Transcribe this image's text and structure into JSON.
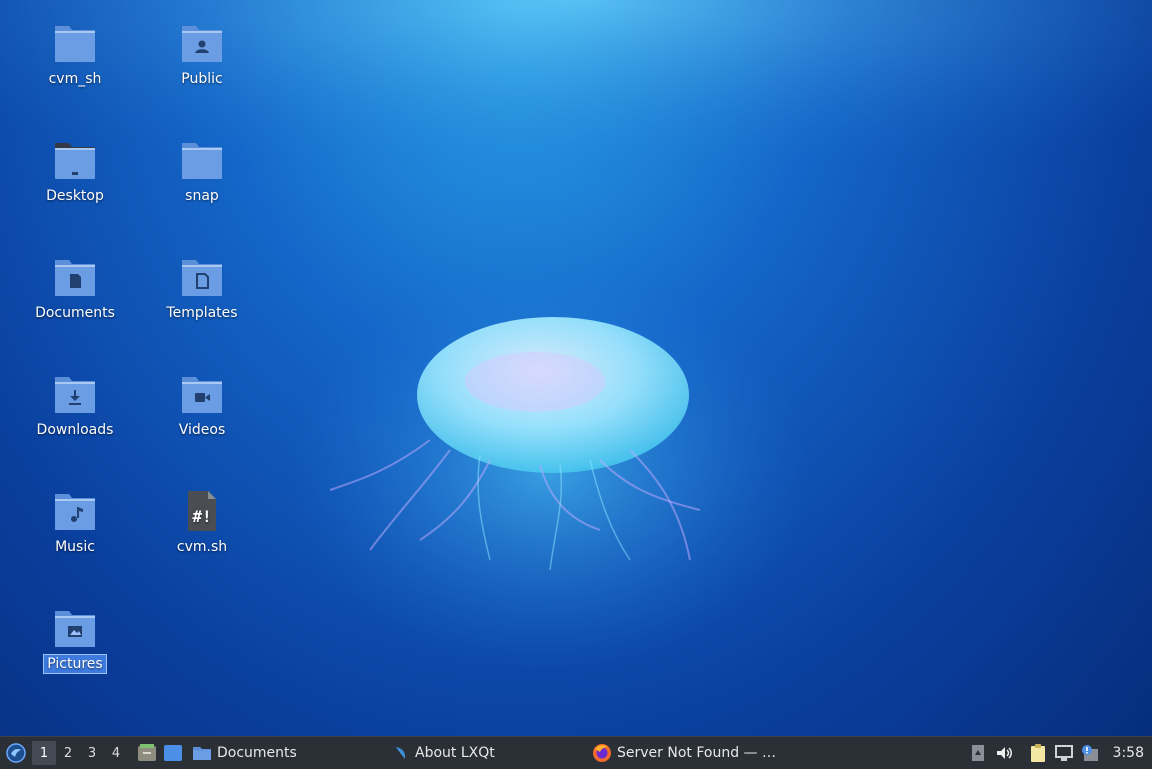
{
  "desktop": {
    "icons": [
      {
        "label": "cvm_sh",
        "icon": "folder-icon"
      },
      {
        "label": "Public",
        "icon": "folder-public-icon"
      },
      {
        "label": "Desktop",
        "icon": "folder-desktop-icon"
      },
      {
        "label": "snap",
        "icon": "folder-icon"
      },
      {
        "label": "Documents",
        "icon": "folder-documents-icon"
      },
      {
        "label": "Templates",
        "icon": "folder-templates-icon"
      },
      {
        "label": "Downloads",
        "icon": "folder-downloads-icon"
      },
      {
        "label": "Videos",
        "icon": "folder-videos-icon"
      },
      {
        "label": "Music",
        "icon": "folder-music-icon"
      },
      {
        "label": "cvm.sh",
        "icon": "shell-script-icon"
      },
      {
        "label": "Pictures",
        "icon": "folder-pictures-icon"
      }
    ],
    "selected": "Pictures"
  },
  "taskbar": {
    "workspaces": [
      "1",
      "2",
      "3",
      "4"
    ],
    "active_workspace": "1",
    "tasks": [
      {
        "label": "Documents",
        "icon": "folder-icon"
      },
      {
        "label": "About LXQt",
        "icon": "lxqt-icon"
      },
      {
        "label": "Server Not Found — …",
        "icon": "firefox-icon"
      }
    ],
    "clock": "3:58"
  },
  "colors": {
    "folder": "#5b8fd9",
    "folder_dark": "#3f6fbf",
    "taskbar": "#2b2f36",
    "selection": "#3d7be0"
  }
}
